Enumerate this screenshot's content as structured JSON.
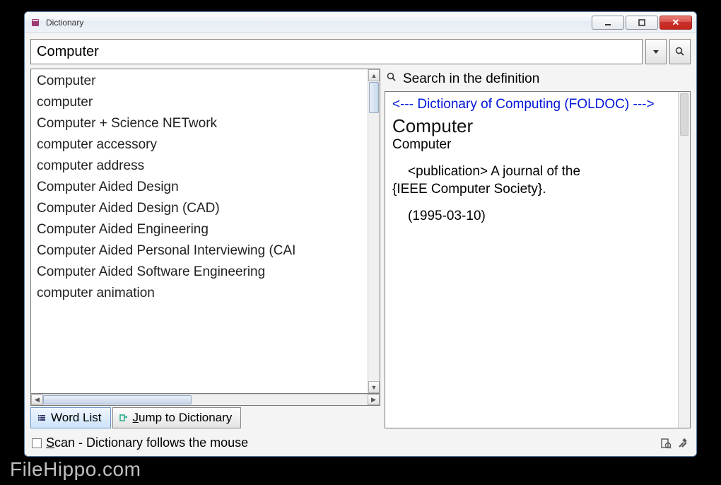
{
  "window": {
    "title": "Dictionary"
  },
  "search": {
    "value": "Computer"
  },
  "word_list": [
    "Computer",
    "computer",
    "Computer + Science NETwork",
    "computer accessory",
    "computer address",
    "Computer Aided Design",
    "Computer Aided Design (CAD)",
    "Computer Aided Engineering",
    "Computer Aided Personal Interviewing (CAI",
    "Computer Aided Software Engineering",
    "computer animation"
  ],
  "tabs": {
    "word_list": "Word List",
    "jump": "Jump to Dictionary"
  },
  "right": {
    "search_in_def": "Search in the definition",
    "source": "<--- Dictionary of Computing (FOLDOC) --->",
    "term": "Computer",
    "sub": "Computer",
    "body_indent": "<publication> A journal of the",
    "body_line2": "{IEEE Computer Society}.",
    "date": "(1995-03-10)"
  },
  "status": {
    "scan_label": "Scan - Dictionary follows the mouse"
  },
  "watermark": "FileHippo.com"
}
